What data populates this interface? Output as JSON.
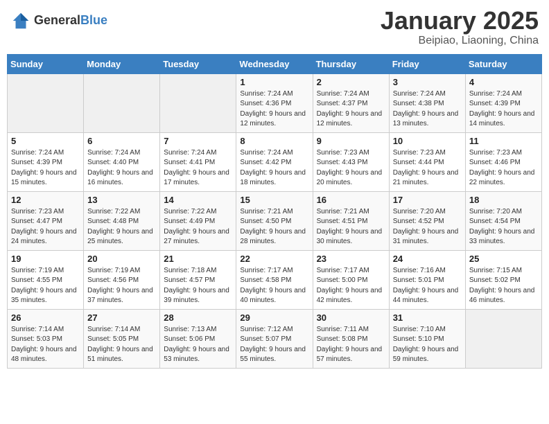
{
  "header": {
    "logo_general": "General",
    "logo_blue": "Blue",
    "month": "January 2025",
    "location": "Beipiao, Liaoning, China"
  },
  "weekdays": [
    "Sunday",
    "Monday",
    "Tuesday",
    "Wednesday",
    "Thursday",
    "Friday",
    "Saturday"
  ],
  "weeks": [
    [
      {
        "day": "",
        "empty": true
      },
      {
        "day": "",
        "empty": true
      },
      {
        "day": "",
        "empty": true
      },
      {
        "day": "1",
        "sunrise": "7:24 AM",
        "sunset": "4:36 PM",
        "daylight": "9 hours and 12 minutes."
      },
      {
        "day": "2",
        "sunrise": "7:24 AM",
        "sunset": "4:37 PM",
        "daylight": "9 hours and 12 minutes."
      },
      {
        "day": "3",
        "sunrise": "7:24 AM",
        "sunset": "4:38 PM",
        "daylight": "9 hours and 13 minutes."
      },
      {
        "day": "4",
        "sunrise": "7:24 AM",
        "sunset": "4:39 PM",
        "daylight": "9 hours and 14 minutes."
      }
    ],
    [
      {
        "day": "5",
        "sunrise": "7:24 AM",
        "sunset": "4:39 PM",
        "daylight": "9 hours and 15 minutes."
      },
      {
        "day": "6",
        "sunrise": "7:24 AM",
        "sunset": "4:40 PM",
        "daylight": "9 hours and 16 minutes."
      },
      {
        "day": "7",
        "sunrise": "7:24 AM",
        "sunset": "4:41 PM",
        "daylight": "9 hours and 17 minutes."
      },
      {
        "day": "8",
        "sunrise": "7:24 AM",
        "sunset": "4:42 PM",
        "daylight": "9 hours and 18 minutes."
      },
      {
        "day": "9",
        "sunrise": "7:23 AM",
        "sunset": "4:43 PM",
        "daylight": "9 hours and 20 minutes."
      },
      {
        "day": "10",
        "sunrise": "7:23 AM",
        "sunset": "4:44 PM",
        "daylight": "9 hours and 21 minutes."
      },
      {
        "day": "11",
        "sunrise": "7:23 AM",
        "sunset": "4:46 PM",
        "daylight": "9 hours and 22 minutes."
      }
    ],
    [
      {
        "day": "12",
        "sunrise": "7:23 AM",
        "sunset": "4:47 PM",
        "daylight": "9 hours and 24 minutes."
      },
      {
        "day": "13",
        "sunrise": "7:22 AM",
        "sunset": "4:48 PM",
        "daylight": "9 hours and 25 minutes."
      },
      {
        "day": "14",
        "sunrise": "7:22 AM",
        "sunset": "4:49 PM",
        "daylight": "9 hours and 27 minutes."
      },
      {
        "day": "15",
        "sunrise": "7:21 AM",
        "sunset": "4:50 PM",
        "daylight": "9 hours and 28 minutes."
      },
      {
        "day": "16",
        "sunrise": "7:21 AM",
        "sunset": "4:51 PM",
        "daylight": "9 hours and 30 minutes."
      },
      {
        "day": "17",
        "sunrise": "7:20 AM",
        "sunset": "4:52 PM",
        "daylight": "9 hours and 31 minutes."
      },
      {
        "day": "18",
        "sunrise": "7:20 AM",
        "sunset": "4:54 PM",
        "daylight": "9 hours and 33 minutes."
      }
    ],
    [
      {
        "day": "19",
        "sunrise": "7:19 AM",
        "sunset": "4:55 PM",
        "daylight": "9 hours and 35 minutes."
      },
      {
        "day": "20",
        "sunrise": "7:19 AM",
        "sunset": "4:56 PM",
        "daylight": "9 hours and 37 minutes."
      },
      {
        "day": "21",
        "sunrise": "7:18 AM",
        "sunset": "4:57 PM",
        "daylight": "9 hours and 39 minutes."
      },
      {
        "day": "22",
        "sunrise": "7:17 AM",
        "sunset": "4:58 PM",
        "daylight": "9 hours and 40 minutes."
      },
      {
        "day": "23",
        "sunrise": "7:17 AM",
        "sunset": "5:00 PM",
        "daylight": "9 hours and 42 minutes."
      },
      {
        "day": "24",
        "sunrise": "7:16 AM",
        "sunset": "5:01 PM",
        "daylight": "9 hours and 44 minutes."
      },
      {
        "day": "25",
        "sunrise": "7:15 AM",
        "sunset": "5:02 PM",
        "daylight": "9 hours and 46 minutes."
      }
    ],
    [
      {
        "day": "26",
        "sunrise": "7:14 AM",
        "sunset": "5:03 PM",
        "daylight": "9 hours and 48 minutes."
      },
      {
        "day": "27",
        "sunrise": "7:14 AM",
        "sunset": "5:05 PM",
        "daylight": "9 hours and 51 minutes."
      },
      {
        "day": "28",
        "sunrise": "7:13 AM",
        "sunset": "5:06 PM",
        "daylight": "9 hours and 53 minutes."
      },
      {
        "day": "29",
        "sunrise": "7:12 AM",
        "sunset": "5:07 PM",
        "daylight": "9 hours and 55 minutes."
      },
      {
        "day": "30",
        "sunrise": "7:11 AM",
        "sunset": "5:08 PM",
        "daylight": "9 hours and 57 minutes."
      },
      {
        "day": "31",
        "sunrise": "7:10 AM",
        "sunset": "5:10 PM",
        "daylight": "9 hours and 59 minutes."
      },
      {
        "day": "",
        "empty": true
      }
    ]
  ],
  "labels": {
    "sunrise_prefix": "Sunrise: ",
    "sunset_prefix": "Sunset: ",
    "daylight_prefix": "Daylight: "
  }
}
